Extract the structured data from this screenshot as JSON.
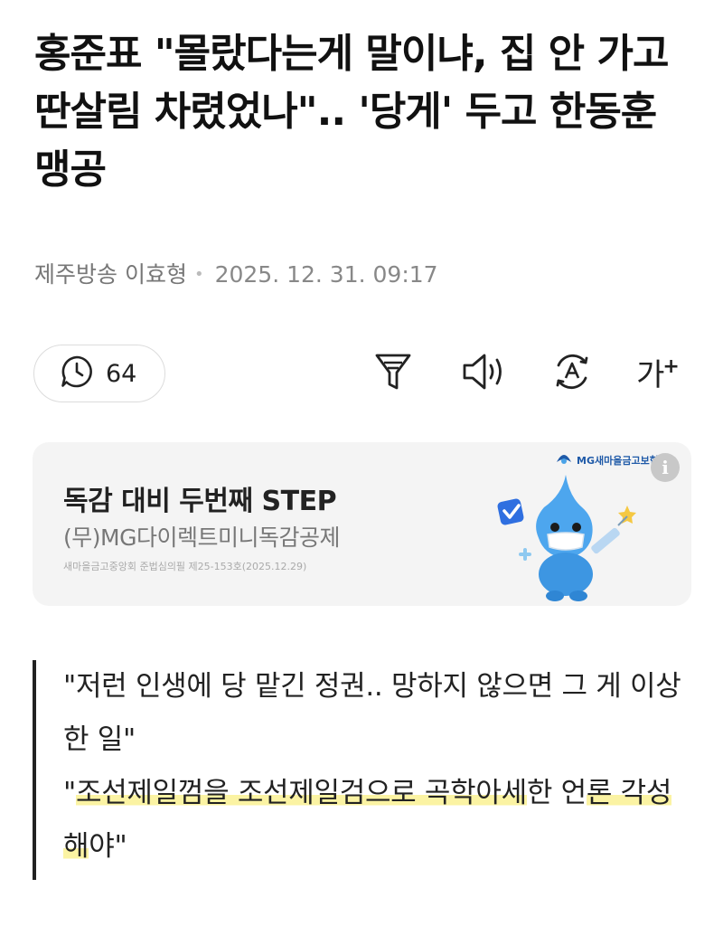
{
  "article": {
    "headline": "홍준표 \"몰랐다는게 말이냐, 집 안 가고 딴살림 차렸었나\".. '당게' 두고 한동훈 맹공",
    "byline": {
      "press": "제주방송 이효형",
      "date": "2025. 12. 31. 09:17"
    }
  },
  "toolbar": {
    "comment_count": "64",
    "comment_icon": "comment-clock-icon",
    "filter_icon": "filter-icon",
    "sound_icon": "speaker-icon",
    "translate_icon": "translate-icon",
    "font_size_label": "가",
    "font_size_plus": "+"
  },
  "ad": {
    "title": "독감 대비 두번째 STEP",
    "subtitle": "(무)MG다이렉트미니독감공제",
    "note": "새마을금고중앙회 준법심의필 제25-153호(2025.12.29)",
    "brand": "MG새마을금고보험",
    "info": "i"
  },
  "quote": {
    "line1": "\"저런 인생에 당 맡긴 정권.. 망하지 않으면 그 게 이상한 일\"",
    "line2_prefix": "\"",
    "line2_hl1": "조선제일껌을 조선제일검으로 곡학아세",
    "line2_mid": "한 언",
    "line2_hl2": "론 각성해",
    "line2_suffix": "야\""
  },
  "colors": {
    "highlight": "#fbf3a3",
    "ad_background": "#f4f4f4",
    "brand_blue": "#1f5aa8"
  }
}
